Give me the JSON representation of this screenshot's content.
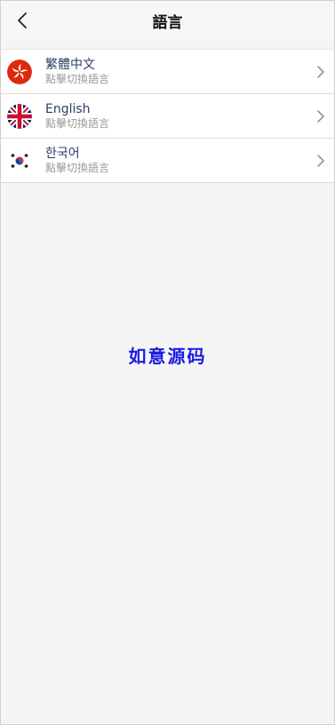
{
  "header": {
    "title": "語言",
    "back_icon": "chevron-left-icon"
  },
  "languages": [
    {
      "name": "繁體中文",
      "subtitle": "點擊切換語言",
      "flag": "hong-kong-flag-icon"
    },
    {
      "name": "English",
      "subtitle": "點擊切換語言",
      "flag": "uk-flag-icon"
    },
    {
      "name": "한국어",
      "subtitle": "點擊切換語言",
      "flag": "korea-flag-icon"
    }
  ],
  "watermark": "如意源码",
  "colors": {
    "background": "#f5f5f5",
    "header": "#f7f7f7",
    "language_text": "#2c3e66",
    "subtitle_text": "#999999",
    "watermark": "#1a1ae6"
  }
}
